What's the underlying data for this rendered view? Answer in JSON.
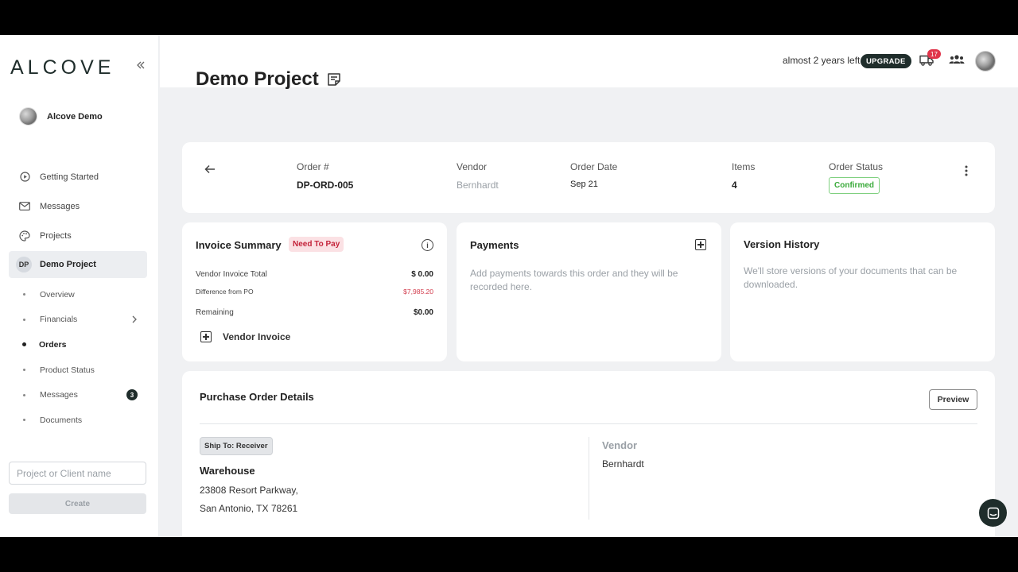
{
  "sidebar": {
    "logo": "ALCOVE",
    "user_name": "Alcove Demo",
    "nav": [
      {
        "label": "Getting Started",
        "icon": "play-circle-icon"
      },
      {
        "label": "Messages",
        "icon": "mail-icon"
      },
      {
        "label": "Projects",
        "icon": "palette-icon"
      },
      {
        "label": "Demo Project",
        "badge": "DP"
      }
    ],
    "sub_items": [
      {
        "label": "Overview"
      },
      {
        "label": "Financials"
      },
      {
        "label": "Orders"
      },
      {
        "label": "Product Status"
      },
      {
        "label": "Messages",
        "count": "3"
      },
      {
        "label": "Documents"
      }
    ],
    "search_placeholder": "Project or Client name",
    "create_label": "Create"
  },
  "topbar": {
    "trial_text": "almost 2 years left",
    "upgrade_label": "UPGRADE",
    "notification_count": "17"
  },
  "page": {
    "title": "Demo Project"
  },
  "order": {
    "order_label": "Order #",
    "order_value": "DP-ORD-005",
    "vendor_label": "Vendor",
    "vendor_value": "Bernhardt",
    "date_label": "Order Date",
    "date_value": "Sep 21",
    "items_label": "Items",
    "items_value": "4",
    "status_label": "Order Status",
    "status_value": "Confirmed"
  },
  "invoice": {
    "title": "Invoice Summary",
    "badge": "Need To Pay",
    "vendor_total_label": "Vendor Invoice Total",
    "vendor_total_value": "$ 0.00",
    "diff_label": "Difference from PO",
    "diff_value": "$7,985.20",
    "remaining_label": "Remaining",
    "remaining_value": "$0.00",
    "add_label": "Vendor Invoice"
  },
  "payments": {
    "title": "Payments",
    "empty_text": "Add payments towards this order and they will be recorded here."
  },
  "versions": {
    "title": "Version History",
    "empty_text": "We'll store versions of your documents that can be downloaded."
  },
  "po": {
    "title": "Purchase Order Details",
    "preview_label": "Preview",
    "ship_to": "Ship To: Receiver",
    "ship_name": "Warehouse",
    "address_line1": "23808 Resort Parkway,",
    "address_line2": "San Antonio, TX 78261",
    "vendor_label": "Vendor",
    "vendor_name": "Bernhardt"
  },
  "colors": {
    "brand": "#1f2d2b",
    "danger": "#d23b4c",
    "success": "#3aaa3a"
  }
}
